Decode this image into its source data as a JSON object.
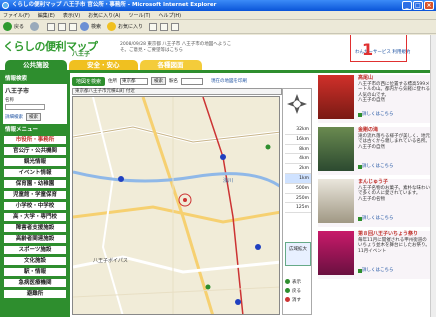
{
  "window": {
    "title": "くらしの便利マップ 八王子市 官公所・事務所 - Microsoft Internet Explorer"
  },
  "menu": [
    "ファイル(F)",
    "編集(E)",
    "表示(V)",
    "お気に入り(A)",
    "ツール(T)",
    "ヘルプ(H)"
  ],
  "toolbar": {
    "back": "戻る",
    "search": "検索",
    "favorites": "お気に入り"
  },
  "site": {
    "logo": "くらしの便利マップ",
    "city_tag": "八王子",
    "notice": "2008/09/28  東京都 八王子市  八王子市の地図へようこそ。ご意見・ご要望等はこちら",
    "toplinks": "わんだーサービス  利用規約",
    "annotation": "1",
    "tabs": [
      "公共施設",
      "安全・安心",
      "各種図面"
    ]
  },
  "sidebar": {
    "search_head": "情報検索",
    "city": "八王子市",
    "name_label": "名称",
    "detail_link": "詳細検索",
    "search_button": "検索",
    "menu_head": "情報メニュー",
    "items": [
      "市役所・事務所",
      "官公庁・公共機関",
      "観光情報",
      "イベント情報",
      "保育園・幼稚園",
      "児童館・学童保育",
      "小学校・中学校",
      "高・大学・専門校",
      "障害者支援施設",
      "高齢者関連施設",
      "スポーツ施設",
      "文化施設",
      "駅・情報",
      "急病医療機関",
      "避難所"
    ]
  },
  "map": {
    "title_button": "地図を検索",
    "address_label": "住所",
    "prefecture": "東京都",
    "search_button": "検索",
    "station_label": "駅名",
    "link": "現在の地図を印刷",
    "address": "東京都八王子市元横山町 付近",
    "zoom_levels": [
      "32km",
      "16km",
      "8km",
      "4km",
      "2km",
      "1km",
      "500m",
      "250m",
      "125m"
    ],
    "selected_zoom": "1km",
    "area_button": "広域拡大",
    "legend": [
      "表示",
      "戻る",
      "消す"
    ],
    "labels": [
      "八王子ボイパス",
      "浅川"
    ]
  },
  "cards": [
    {
      "title": "高尾山",
      "text": "八王子市の西に位置する標高599メートルの山。都内から気軽に登れる人気の山です。",
      "tag": "八王子の自然",
      "more": "詳しくはこちら"
    },
    {
      "title": "金剛の滝",
      "text": "滝の流れ落ちる様子が美しく、地元では古くから親しまれている名所。",
      "tag": "八王子の自然",
      "more": "詳しくはこちら"
    },
    {
      "title": "まんじゅう子",
      "text": "八王子名物のお菓子。素朴な味わいで多くの人に愛されています。",
      "tag": "八王子の名物",
      "more": "詳しくはこちら"
    },
    {
      "title": "第８回八王子いちょう祭り",
      "text": "毎年11月に開催される甲州街道のいちょう並木を舞台にしたお祭り。",
      "tag": "11月イベント",
      "more": "詳しくはこちら"
    }
  ]
}
